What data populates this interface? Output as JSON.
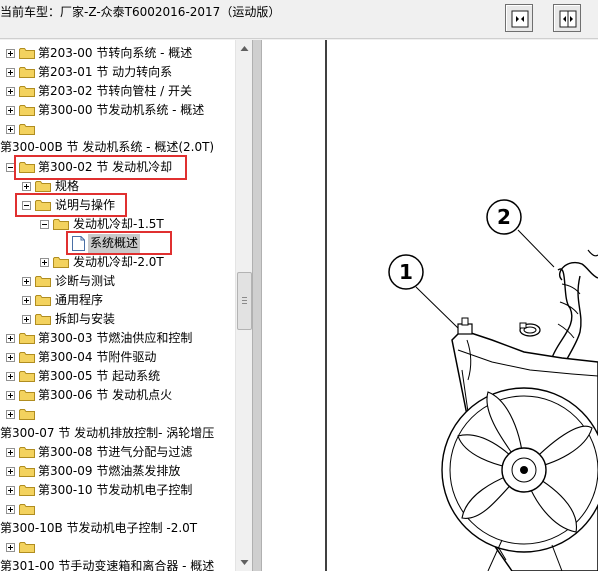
{
  "header": {
    "title": "当前车型：厂家-Z-众泰T6002016-2017（运动版）",
    "buttons": [
      {
        "name": "single-view-button",
        "icon": "single-page-icon"
      },
      {
        "name": "split-view-button",
        "icon": "split-page-icon"
      }
    ]
  },
  "tree": {
    "items": [
      {
        "label": "第203-00 节转向系统 - 概述"
      },
      {
        "label": "第203-01 节 动力转向系"
      },
      {
        "label": "第203-02 节转向管柱 / 开关"
      },
      {
        "label": "第300-00 节发动机系统 - 概述"
      },
      {
        "label": ""
      },
      {
        "label": "第300-00B 节 发动机系统 - 概述(2.0T)"
      },
      {
        "label": "第300-02 节 发动机冷却"
      },
      {
        "label": "规格"
      },
      {
        "label": "说明与操作"
      },
      {
        "label": "发动机冷却-1.5T"
      },
      {
        "label": "系统概述"
      },
      {
        "label": "发动机冷却-2.0T"
      },
      {
        "label": "诊断与测试"
      },
      {
        "label": "通用程序"
      },
      {
        "label": "拆卸与安装"
      },
      {
        "label": "第300-03 节燃油供应和控制"
      },
      {
        "label": "第300-04 节附件驱动"
      },
      {
        "label": "第300-05 节 起动系统"
      },
      {
        "label": "第300-06 节 发动机点火"
      },
      {
        "label": ""
      },
      {
        "label": "第300-07 节 发动机排放控制- 涡轮增压"
      },
      {
        "label": "第300-08 节进气分配与过滤"
      },
      {
        "label": "第300-09 节燃油蒸发排放"
      },
      {
        "label": "第300-10 节发动机电子控制"
      },
      {
        "label": ""
      },
      {
        "label": "第300-10B 节发动机电子控制 -2.0T"
      },
      {
        "label": ""
      },
      {
        "label": "第301-00 节手动变速箱和离合器 - 概述"
      }
    ]
  },
  "diagram": {
    "callouts": [
      "1",
      "2"
    ]
  },
  "colors": {
    "highlight": "#e03030",
    "folder": "#f3d25e",
    "selection": "#c9c9c9"
  }
}
